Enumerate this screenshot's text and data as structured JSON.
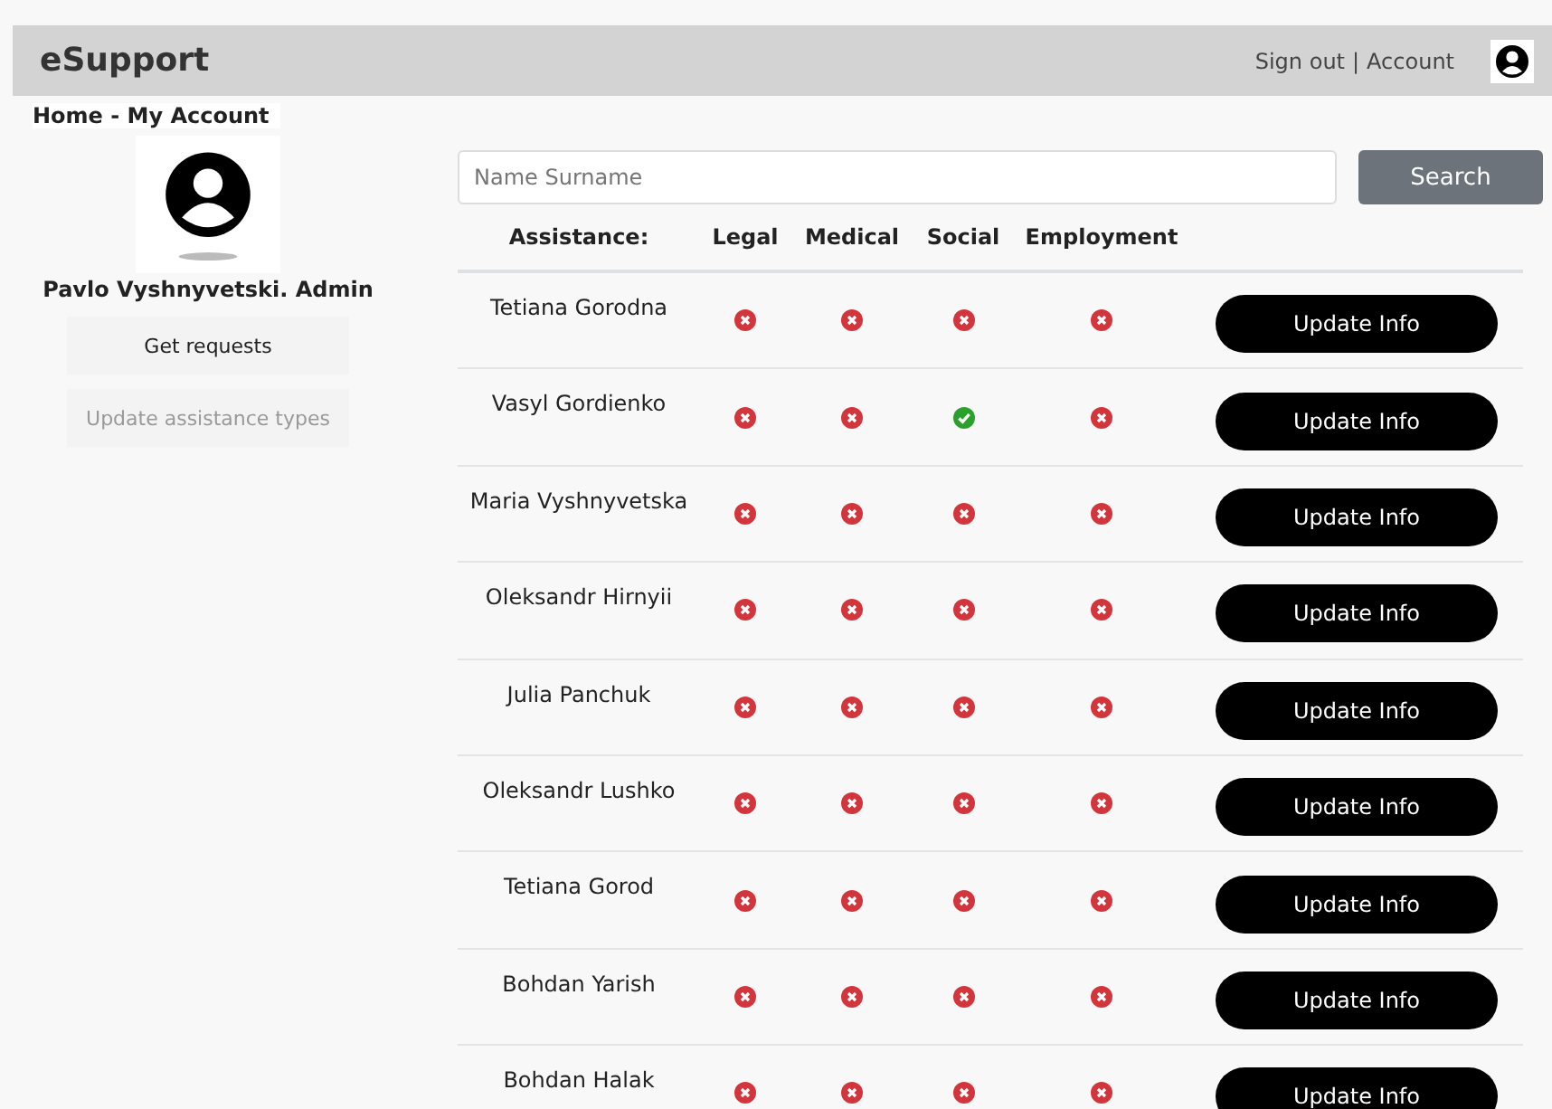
{
  "header": {
    "brand": "eSupport",
    "sign_out": "Sign out",
    "separator": "|",
    "account": "Account"
  },
  "breadcrumb": "Home - My Account",
  "profile": {
    "name": "Pavlo Vyshnyvetski. Admin"
  },
  "sidebar": {
    "items": [
      {
        "label": "Get requests",
        "disabled": false
      },
      {
        "label": "Update assistance types",
        "disabled": true
      }
    ]
  },
  "search": {
    "placeholder": "Name Surname",
    "button": "Search"
  },
  "table": {
    "columns": [
      "Assistance:",
      "Legal",
      "Medical",
      "Social",
      "Employment"
    ],
    "rows": [
      {
        "name": "Tetiana Gorodna",
        "legal": false,
        "medical": false,
        "social": false,
        "employment": false,
        "button": "Update Info"
      },
      {
        "name": "Vasyl Gordienko",
        "legal": false,
        "medical": false,
        "social": true,
        "employment": false,
        "button": "Update Info"
      },
      {
        "name": "Maria Vyshnyvetska",
        "legal": false,
        "medical": false,
        "social": false,
        "employment": false,
        "button": "Update Info"
      },
      {
        "name": "Oleksandr Hirnyii",
        "legal": false,
        "medical": false,
        "social": false,
        "employment": false,
        "button": "Update Info"
      },
      {
        "name": "Julia Panchuk",
        "legal": false,
        "medical": false,
        "social": false,
        "employment": false,
        "button": "Update Info"
      },
      {
        "name": "Oleksandr Lushko",
        "legal": false,
        "medical": false,
        "social": false,
        "employment": false,
        "button": "Update Info"
      },
      {
        "name": "Tetiana Gorod",
        "legal": false,
        "medical": false,
        "social": false,
        "employment": false,
        "button": "Update Info"
      },
      {
        "name": "Bohdan Yarish",
        "legal": false,
        "medical": false,
        "social": false,
        "employment": false,
        "button": "Update Info"
      },
      {
        "name": "Bohdan Halak",
        "legal": false,
        "medical": false,
        "social": false,
        "employment": false,
        "button": "Update Info"
      }
    ]
  }
}
